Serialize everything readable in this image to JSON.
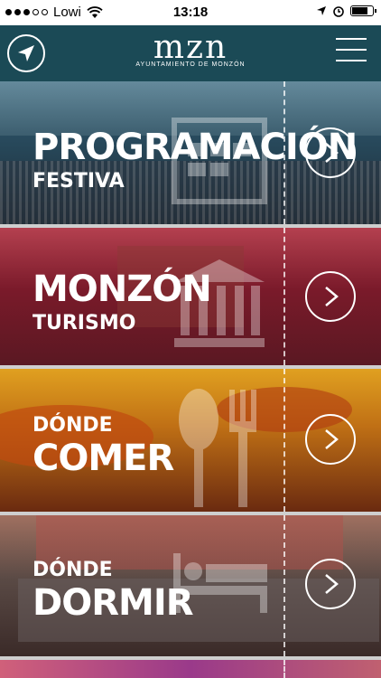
{
  "status_bar": {
    "carrier": "Lowi",
    "time": "13:18"
  },
  "header": {
    "logo_text": "mzn",
    "logo_subtext": "AYUNTAMIENTO DE MONZÓN",
    "left_icon": "location-arrow-icon",
    "right_icon": "hamburger-menu-icon"
  },
  "sections": [
    {
      "line1": "PROGRAMACIÓN",
      "line2": "FESTIVA",
      "icon": "calendar-icon"
    },
    {
      "line1": "MONZÓN",
      "line2": "TURISMO",
      "icon": "monument-icon"
    },
    {
      "line1": "DÓNDE",
      "line2": "COMER",
      "icon": "fork-knife-icon"
    },
    {
      "line1": "DÓNDE",
      "line2": "DORMIR",
      "icon": "bed-icon"
    }
  ],
  "colors": {
    "header_bg": "#1b4a56",
    "panel1": "#26465c",
    "panel2": "#7a1a2a",
    "panel3": "#c07015",
    "panel4": "#5a4a45"
  }
}
